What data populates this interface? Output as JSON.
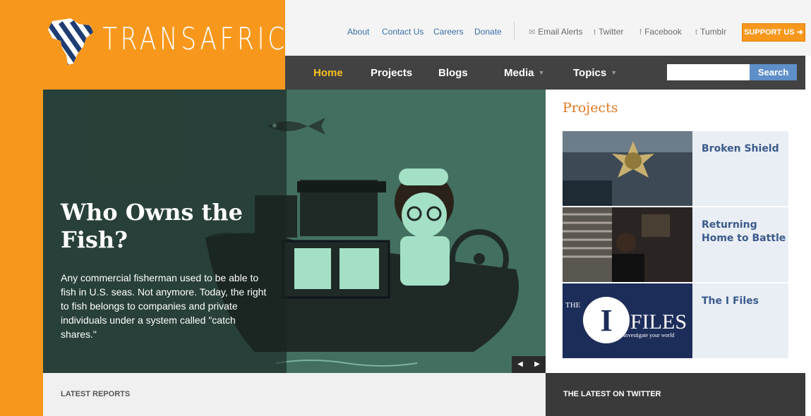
{
  "brand": {
    "name": "TRANSAFRICA",
    "accent_orange": "#f7981d",
    "nav_dark": "#424242"
  },
  "utility_nav": {
    "links": [
      "About",
      "Contact Us",
      "Careers",
      "Donate"
    ],
    "social": [
      {
        "label": "Email Alerts",
        "icon": "envelope-icon"
      },
      {
        "label": "Twitter",
        "icon": "twitter-icon"
      },
      {
        "label": "Facebook",
        "icon": "facebook-icon"
      },
      {
        "label": "Tumblr",
        "icon": "tumblr-icon"
      }
    ],
    "support_label": "SUPPORT US"
  },
  "main_nav": {
    "items": [
      {
        "label": "Home",
        "active": true
      },
      {
        "label": "Projects"
      },
      {
        "label": "Blogs"
      },
      {
        "label": "Media",
        "dropdown": true
      },
      {
        "label": "Topics",
        "dropdown": true
      }
    ],
    "search": {
      "placeholder": "",
      "button_label": "Search"
    }
  },
  "hero": {
    "title": "Who Owns the Fish?",
    "text": "Any commercial fisherman used to be able to fish in U.S. seas. Not anymore. Today, the right to fish belongs to companies and private individuals under a system called \"catch shares.\""
  },
  "projects": {
    "title": "Projects",
    "items": [
      {
        "label": "Broken Shield"
      },
      {
        "label": "Returning Home to Battle"
      },
      {
        "label": "The I Files",
        "image_text": {
          "the": "THE",
          "letter": "I",
          "files": "FILES",
          "tagline": "Investigate your world"
        }
      }
    ]
  },
  "footer_sections": {
    "latest_reports": "LATEST REPORTS",
    "twitter": "THE LATEST ON TWITTER"
  }
}
